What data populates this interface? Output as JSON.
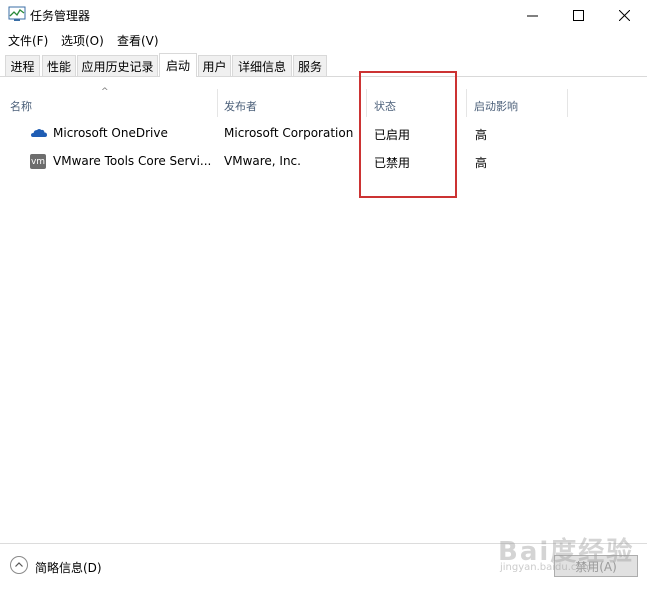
{
  "window": {
    "title": "任务管理器"
  },
  "menu": [
    "文件(F)",
    "选项(O)",
    "查看(V)"
  ],
  "tabs": [
    "进程",
    "性能",
    "应用历史记录",
    "启动",
    "用户",
    "详细信息",
    "服务"
  ],
  "active_tab": "启动",
  "columns": {
    "name": "名称",
    "publisher": "发布者",
    "status": "状态",
    "impact": "启动影响"
  },
  "rows": [
    {
      "icon": "onedrive-icon",
      "name": "Microsoft OneDrive",
      "publisher": "Microsoft Corporation",
      "status": "已启用",
      "impact": "高"
    },
    {
      "icon": "vmware-icon",
      "icon_text": "vm",
      "name": "VMware Tools Core Servi...",
      "publisher": "VMware, Inc.",
      "status": "已禁用",
      "impact": "高"
    }
  ],
  "footer": {
    "details_label": "简略信息(D)",
    "disable_button": "禁用(A)"
  },
  "watermark": {
    "text": "Bai度经验",
    "sub": "jingyan.baidu.com"
  },
  "colors": {
    "highlight": "#cc3333",
    "header_text": "#4c607a",
    "onedrive": "#1f5db4"
  }
}
